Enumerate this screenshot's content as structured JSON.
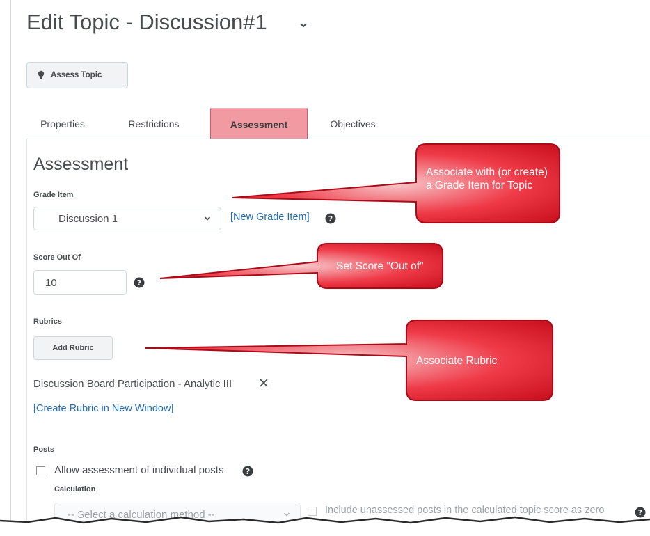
{
  "header": {
    "title": "Edit Topic - Discussion#1"
  },
  "toolbar": {
    "assess_label": "Assess Topic"
  },
  "tabs": [
    {
      "label": "Properties"
    },
    {
      "label": "Restrictions"
    },
    {
      "label": "Assessment"
    },
    {
      "label": "Objectives"
    }
  ],
  "assessment": {
    "section_title": "Assessment",
    "grade_item_label": "Grade Item",
    "grade_item_value": "Discussion 1",
    "new_grade_item_link": "[New Grade Item]",
    "score_label": "Score Out Of",
    "score_value": "10",
    "rubrics_label": "Rubrics",
    "add_rubric_label": "Add Rubric",
    "rubric_name": "Discussion Board Participation - Analytic III",
    "create_rubric_link": "[Create Rubric in New Window]",
    "posts_label": "Posts",
    "allow_individual_label": "Allow assessment of individual posts",
    "calculation_label": "Calculation",
    "calculation_placeholder": "-- Select a calculation method --",
    "include_unassessed_label": "Include unassessed posts in the calculated topic score as zero"
  },
  "callouts": [
    {
      "text": "Associate with (or create) a Grade Item for Topic"
    },
    {
      "text": "Set Score \"Out of\""
    },
    {
      "text": "Associate Rubric"
    }
  ],
  "colors": {
    "accent_link": "#1f6bb7",
    "active_tab": "#f29aa2",
    "callout_fill": "#d5101f",
    "text": "#494c4e"
  }
}
